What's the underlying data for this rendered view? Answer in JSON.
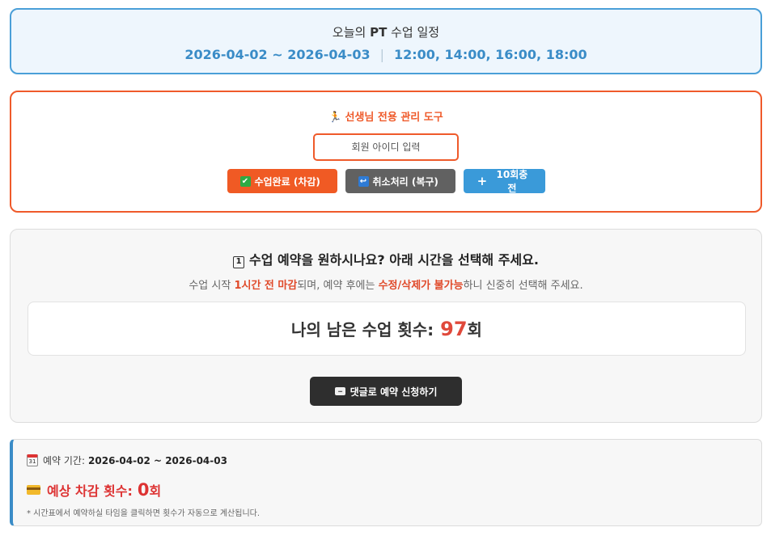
{
  "schedule": {
    "title_prefix": "오늘의 ",
    "title_bold": "PT",
    "title_suffix": " 수업 일정",
    "date_range": "2026-04-02 ~ 2026-04-03",
    "separator": "|",
    "times": "12:00, 14:00, 16:00, 18:00"
  },
  "admin": {
    "title": "선생님 전용 관리 도구",
    "title_icon": "runner-icon",
    "member_input_placeholder": "회원 아이디 입력",
    "buttons": {
      "complete_label": "수업완료 (차감)",
      "complete_icon": "✔",
      "cancel_label": "취소처리 (복구)",
      "cancel_icon": "↩",
      "charge_label": "10회충전",
      "charge_icon": "+"
    }
  },
  "booking": {
    "question_icon": "1",
    "question": "수업 예약을 원하시나요? 아래 시간을 선택해 주세요.",
    "notice_part1": "수업 시작 ",
    "notice_highlight1": "1시간 전 마감",
    "notice_part2": "되며, 예약 후에는 ",
    "notice_highlight2": "수정/삭제가 불가능",
    "notice_part3": "하니 신중히 선택해 주세요.",
    "remain_label": "나의 남은 수업 횟수:",
    "remain_count": "97",
    "remain_unit": "회",
    "comment_button_label": "댓글로 예약 신청하기",
    "comment_icon": "..."
  },
  "period": {
    "calendar_icon_text": "31",
    "label": "예약 기간:",
    "value": "2026-04-02 ~ 2026-04-03",
    "deduct_label": "예상 차감 횟수:",
    "deduct_count": "0",
    "deduct_unit": "회",
    "hint": "* 시간표에서 예약하실 타임을 클릭하면 횟수가 자동으로 계산됩니다."
  },
  "colors": {
    "schedule_border": "#4a9fd8",
    "admin_accent": "#ef5a2a",
    "complete_button": "#f05a24",
    "cancel_button": "#616161",
    "charge_button": "#3a9ad9",
    "remain_count": "#e0493b",
    "comment_button": "#2e2e2e",
    "deduct_text": "#d33333"
  }
}
